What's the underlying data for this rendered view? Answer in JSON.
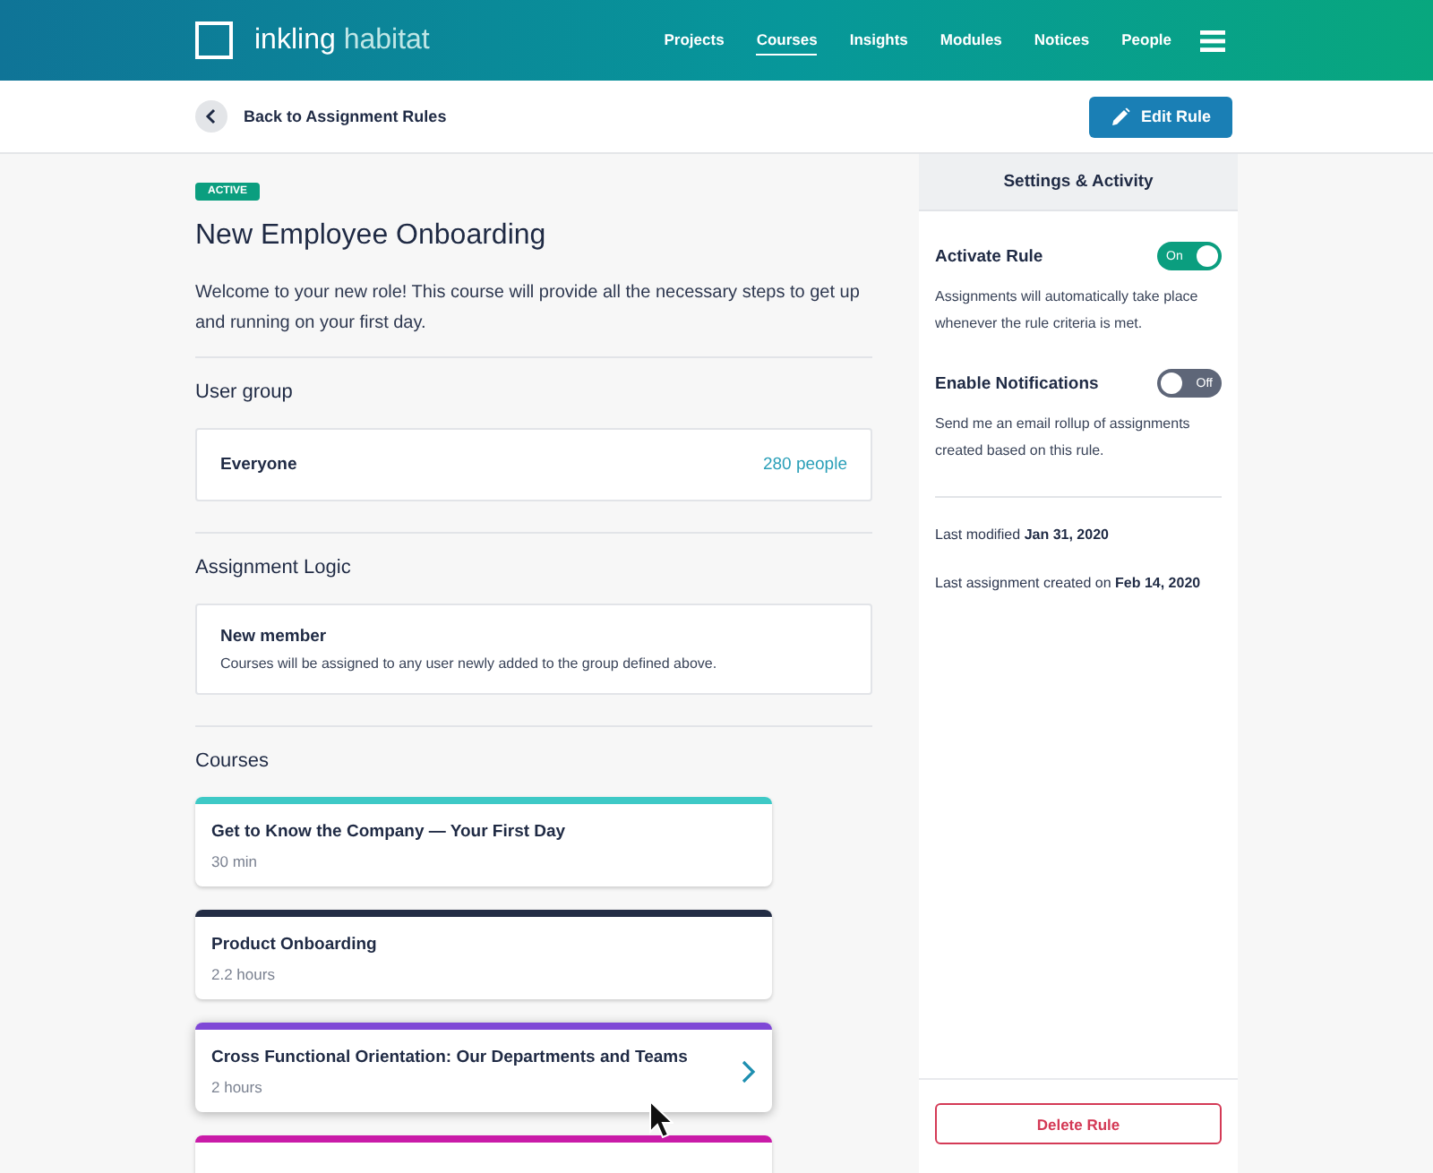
{
  "header": {
    "logo": {
      "primary": "inkling",
      "secondary": "habitat"
    },
    "nav": [
      {
        "label": "Projects",
        "selected": false
      },
      {
        "label": "Courses",
        "selected": true
      },
      {
        "label": "Insights",
        "selected": false
      },
      {
        "label": "Modules",
        "selected": false
      },
      {
        "label": "Notices",
        "selected": false
      },
      {
        "label": "People",
        "selected": false
      }
    ]
  },
  "toolbar": {
    "back_link": "Back to Assignment Rules",
    "edit_button": "Edit Rule"
  },
  "rule": {
    "status": "ACTIVE",
    "title": "New Employee Onboarding",
    "description": "Welcome to your new role! This course will provide all the necessary steps to get up and running on your first day."
  },
  "user_group": {
    "heading": "User group",
    "name": "Everyone",
    "count": "280 people"
  },
  "assignment_logic": {
    "heading": "Assignment Logic",
    "name": "New member",
    "description": "Courses will be assigned to any user newly added to the group defined above."
  },
  "courses": {
    "heading": "Courses",
    "items": [
      {
        "title": "Get to Know the Company — Your First Day",
        "duration": "30 min",
        "color": "#3ec9c6",
        "hovered": false
      },
      {
        "title": "Product Onboarding",
        "duration": "2.2 hours",
        "color": "#232d45",
        "hovered": false
      },
      {
        "title": "Cross Functional Orientation: Our Departments and Teams",
        "duration": "2 hours",
        "color": "#7f47d6",
        "hovered": true
      },
      {
        "color": "#c91ba8",
        "hovered": false
      }
    ]
  },
  "settings": {
    "title": "Settings & Activity",
    "toggles": [
      {
        "label": "Activate Rule",
        "on": true,
        "state_label": "On",
        "description": "Assignments will automatically take place whenever the rule criteria is met."
      },
      {
        "label": "Enable Notifications",
        "on": false,
        "state_label": "Off",
        "description": "Send me an email rollup of assignments created based on this rule."
      }
    ],
    "activity": [
      "Last modified **Jan 31, 2020**",
      "Last assignment created on **Feb 14, 2020**"
    ],
    "delete_button": "Delete Rule"
  }
}
